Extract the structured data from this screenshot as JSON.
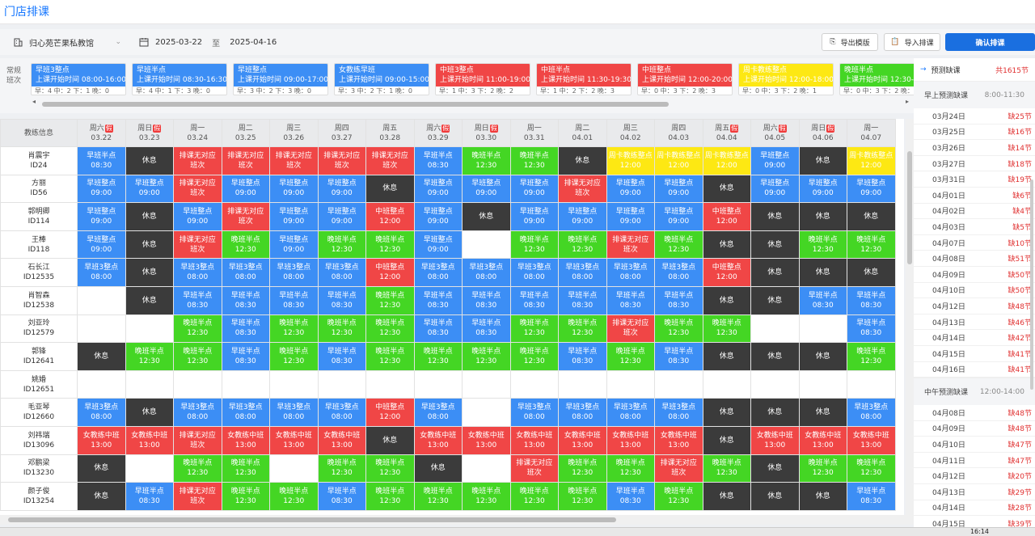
{
  "title": "门店排课",
  "toolbar": {
    "store": "归心苑芒果私教馆",
    "date_from": "2025-03-22",
    "date_sep": "至",
    "date_to": "2025-04-16",
    "export_label": "导出模版",
    "import_label": "导入排课",
    "confirm_label": "确认排课"
  },
  "shift_label": "常规班次",
  "shifts": [
    {
      "name": "早班3整点",
      "time": "上课开始时间 08:00-16:00",
      "stats": "早：4 中：2 下：1 晚：0",
      "color": "blue"
    },
    {
      "name": "早班半点",
      "time": "上课开始时间 08:30-16:30",
      "stats": "早：4 中：1 下：3 晚：0",
      "color": "blue"
    },
    {
      "name": "早班整点",
      "time": "上课开始时间 09:00-17:00",
      "stats": "早：3 中：2 下：3 晚：0",
      "color": "blue"
    },
    {
      "name": "女教练早班",
      "time": "上课开始时间 09:00-15:00",
      "stats": "早：3 中：2 下：1 晚：0",
      "color": "blue"
    },
    {
      "name": "中班3整点",
      "time": "上课开始时间 11:00-19:00",
      "stats": "早：1 中：3 下：2 晚：2",
      "color": "red"
    },
    {
      "name": "中班半点",
      "time": "上课开始时间 11:30-19:30",
      "stats": "早：1 中：2 下：2 晚：3",
      "color": "red"
    },
    {
      "name": "中班整点",
      "time": "上课开始时间 12:00-20:00",
      "stats": "早：0 中：3 下：2 晚：3",
      "color": "red"
    },
    {
      "name": "周卡教练整点",
      "time": "上课开始时间 12:00-18:00",
      "stats": "早：0 中：3 下：2 晚：1",
      "color": "yellow"
    },
    {
      "name": "晚班半点",
      "time": "上课开始时间 12:30-",
      "stats": "早：0 中：3 下：2 晚：3",
      "color": "green"
    }
  ],
  "grid": {
    "coach_header": "教练信息",
    "days": [
      {
        "wd": "周六",
        "date": "03.22",
        "hol": true
      },
      {
        "wd": "周日",
        "date": "03.23",
        "hol": true
      },
      {
        "wd": "周一",
        "date": "03.24",
        "hol": false
      },
      {
        "wd": "周二",
        "date": "03.25",
        "hol": false
      },
      {
        "wd": "周三",
        "date": "03.26",
        "hol": false
      },
      {
        "wd": "周四",
        "date": "03.27",
        "hol": false
      },
      {
        "wd": "周五",
        "date": "03.28",
        "hol": false
      },
      {
        "wd": "周六",
        "date": "03.29",
        "hol": true
      },
      {
        "wd": "周日",
        "date": "03.30",
        "hol": true
      },
      {
        "wd": "周一",
        "date": "03.31",
        "hol": false
      },
      {
        "wd": "周二",
        "date": "04.01",
        "hol": false
      },
      {
        "wd": "周三",
        "date": "04.02",
        "hol": false
      },
      {
        "wd": "周四",
        "date": "04.03",
        "hol": false
      },
      {
        "wd": "周五",
        "date": "04.04",
        "hol": true
      },
      {
        "wd": "周六",
        "date": "04.05",
        "hol": true
      },
      {
        "wd": "周日",
        "date": "04.06",
        "hol": true
      },
      {
        "wd": "周一",
        "date": "04.07",
        "hol": false
      }
    ],
    "hol_badge": "假",
    "rows": [
      {
        "name": "肖震宇",
        "id": "ID24",
        "cells": [
          "B|早班半点|08:30",
          "D|休息|",
          "R|排课无对应|班次",
          "R|排课无对应|班次",
          "R|排课无对应|班次",
          "R|排课无对应|班次",
          "R|排课无对应|班次",
          "B|早班半点|08:30",
          "G|晚班半点|12:30",
          "G|晚班半点|12:30",
          "D|休息|",
          "Y|周卡教练整点|12:00",
          "Y|周卡教练整点|12:00",
          "Y|周卡教练整点|12:00",
          "B|早班整点|09:00",
          "D|休息|",
          "Y|周卡教练整点|12:00"
        ]
      },
      {
        "name": "方丽",
        "id": "ID56",
        "cells": [
          "B|早班整点|09:00",
          "B|早班整点|09:00",
          "R|排课无对应|班次",
          "B|早班整点|09:00",
          "B|早班整点|09:00",
          "B|早班整点|09:00",
          "D|休息|",
          "B|早班整点|09:00",
          "B|早班整点|09:00",
          "B|早班整点|09:00",
          "R|排课无对应|班次",
          "B|早班整点|09:00",
          "B|早班整点|09:00",
          "D|休息|",
          "B|早班整点|09:00",
          "B|早班整点|09:00",
          "B|早班整点|09:00"
        ]
      },
      {
        "name": "郭明卿",
        "id": "ID114",
        "cells": [
          "B|早班整点|09:00",
          "D|休息|",
          "B|早班整点|09:00",
          "R|排课无对应|班次",
          "B|早班整点|09:00",
          "B|早班整点|09:00",
          "R|中班整点|12:00",
          "B|早班整点|09:00",
          "D|休息|",
          "B|早班整点|09:00",
          "B|早班整点|09:00",
          "B|早班整点|09:00",
          "B|早班整点|09:00",
          "R|中班整点|12:00",
          "D|休息|",
          "D|休息|",
          "D|休息|"
        ]
      },
      {
        "name": "王棒",
        "id": "ID118",
        "cells": [
          "B|早班整点|09:00",
          "D|休息|",
          "R|排课无对应|班次",
          "G|晚班半点|12:30",
          "B|早班整点|09:00",
          "G|晚班半点|12:30",
          "G|晚班半点|12:30",
          "B|早班整点|09:00",
          "E||",
          "G|晚班半点|12:30",
          "G|晚班半点|12:30",
          "R|排课无对应|班次",
          "G|晚班半点|12:30",
          "D|休息|",
          "D|休息|",
          "G|晚班半点|12:30",
          "G|晚班半点|12:30"
        ]
      },
      {
        "name": "石长江",
        "id": "ID12535",
        "cells": [
          "B|早班3整点|08:00",
          "D|休息|",
          "B|早班3整点|08:00",
          "B|早班3整点|08:00",
          "B|早班3整点|08:00",
          "B|早班3整点|08:00",
          "R|中班整点|12:00",
          "B|早班3整点|08:00",
          "B|早班3整点|08:00",
          "B|早班3整点|08:00",
          "B|早班3整点|08:00",
          "B|早班3整点|08:00",
          "B|早班3整点|08:00",
          "R|中班整点|12:00",
          "D|休息|",
          "D|休息|",
          "D|休息|"
        ]
      },
      {
        "name": "肖智森",
        "id": "ID12538",
        "cells": [
          "E||",
          "D|休息|",
          "B|早班半点|08:30",
          "B|早班半点|08:30",
          "B|早班半点|08:30",
          "B|早班半点|08:30",
          "G|晚班半点|12:30",
          "B|早班半点|08:30",
          "B|早班半点|08:30",
          "B|早班半点|08:30",
          "B|早班半点|08:30",
          "B|早班半点|08:30",
          "B|早班半点|08:30",
          "D|休息|",
          "D|休息|",
          "B|早班半点|08:30",
          "B|早班半点|08:30"
        ]
      },
      {
        "name": "刘亚玲",
        "id": "ID12579",
        "cells": [
          "E||",
          "E||",
          "G|晚班半点|12:30",
          "B|早班半点|08:30",
          "G|晚班半点|12:30",
          "G|晚班半点|12:30",
          "G|晚班半点|12:30",
          "B|早班半点|08:30",
          "B|早班半点|08:30",
          "G|晚班半点|12:30",
          "G|晚班半点|12:30",
          "R|排课无对应|班次",
          "G|晚班半点|12:30",
          "G|晚班半点|12:30",
          "E||",
          "E||",
          "B|早班半点|08:30"
        ]
      },
      {
        "name": "郭锋",
        "id": "ID12641",
        "cells": [
          "D|休息|",
          "G|晚班半点|12:30",
          "G|晚班半点|12:30",
          "B|早班半点|08:30",
          "G|晚班半点|12:30",
          "B|早班半点|08:30",
          "G|晚班半点|12:30",
          "G|晚班半点|12:30",
          "G|晚班半点|12:30",
          "G|晚班半点|12:30",
          "B|早班半点|08:30",
          "G|晚班半点|12:30",
          "B|早班半点|08:30",
          "D|休息|",
          "D|休息|",
          "D|休息|",
          "G|晚班半点|12:30"
        ]
      },
      {
        "name": "姚婚",
        "id": "ID12651",
        "cells": [
          "E||",
          "E||",
          "E||",
          "E||",
          "E||",
          "E||",
          "E||",
          "E||",
          "E||",
          "E||",
          "E||",
          "E||",
          "E||",
          "E||",
          "E||",
          "E||",
          "E||"
        ]
      },
      {
        "name": "毛亚琴",
        "id": "ID12660",
        "cells": [
          "B|早班3整点|08:00",
          "D|休息|",
          "B|早班3整点|08:00",
          "B|早班3整点|08:00",
          "B|早班3整点|08:00",
          "B|早班3整点|08:00",
          "R|中班整点|12:00",
          "B|早班3整点|08:00",
          "E||",
          "B|早班3整点|08:00",
          "B|早班3整点|08:00",
          "B|早班3整点|08:00",
          "B|早班3整点|08:00",
          "D|休息|",
          "D|休息|",
          "D|休息|",
          "B|早班3整点|08:00"
        ]
      },
      {
        "name": "刘祎瑞",
        "id": "ID13096",
        "cells": [
          "R|女教练中班|13:00",
          "R|女教练中班|13:00",
          "R|排课无对应|班次",
          "R|女教练中班|13:00",
          "R|女教练中班|13:00",
          "R|女教练中班|13:00",
          "D|休息|",
          "R|女教练中班|13:00",
          "R|女教练中班|13:00",
          "R|女教练中班|13:00",
          "R|女教练中班|13:00",
          "R|女教练中班|13:00",
          "R|女教练中班|13:00",
          "D|休息|",
          "R|女教练中班|13:00",
          "R|女教练中班|13:00",
          "R|女教练中班|13:00"
        ]
      },
      {
        "name": "邓鹏梁",
        "id": "ID13230",
        "cells": [
          "D|休息|",
          "E||",
          "G|晚班半点|12:30",
          "G|晚班半点|12:30",
          "E||",
          "G|晚班半点|12:30",
          "G|晚班半点|12:30",
          "D|休息|",
          "E||",
          "R|排课无对应|班次",
          "G|晚班半点|12:30",
          "G|晚班半点|12:30",
          "R|排课无对应|班次",
          "G|晚班半点|12:30",
          "D|休息|",
          "G|晚班半点|12:30",
          "G|晚班半点|12:30"
        ]
      },
      {
        "name": "颜子俊",
        "id": "ID13254",
        "cells": [
          "D|休息|",
          "B|早班半点|08:30",
          "R|排课无对应|班次",
          "G|晚班半点|12:30",
          "G|晚班半点|12:30",
          "B|早班半点|08:30",
          "G|晚班半点|12:30",
          "G|晚班半点|12:30",
          "G|晚班半点|12:30",
          "G|晚班半点|12:30",
          "G|晚班半点|12:30",
          "B|早班半点|08:30",
          "G|晚班半点|12:30",
          "D|休息|",
          "D|休息|",
          "D|休息|",
          "B|早班半点|08:30"
        ]
      }
    ]
  },
  "side": {
    "header": "预测缺课",
    "total": "共1615节",
    "sections": [
      {
        "title": "早上预测缺课",
        "range": "8:00-11:30",
        "items": [
          [
            "03月24日",
            "缺25节"
          ],
          [
            "03月25日",
            "缺16节"
          ],
          [
            "03月26日",
            "缺14节"
          ],
          [
            "03月27日",
            "缺18节"
          ],
          [
            "03月31日",
            "缺19节"
          ],
          [
            "04月01日",
            "缺6节"
          ],
          [
            "04月02日",
            "缺4节"
          ],
          [
            "04月03日",
            "缺5节"
          ],
          [
            "04月07日",
            "缺10节"
          ],
          [
            "04月08日",
            "缺51节"
          ],
          [
            "04月09日",
            "缺50节"
          ],
          [
            "04月10日",
            "缺50节"
          ],
          [
            "04月12日",
            "缺48节"
          ],
          [
            "04月13日",
            "缺46节"
          ],
          [
            "04月14日",
            "缺42节"
          ],
          [
            "04月15日",
            "缺41节"
          ],
          [
            "04月16日",
            "缺41节"
          ]
        ]
      },
      {
        "title": "中午预测缺课",
        "range": "12:00-14:00",
        "items": [
          [
            "04月08日",
            "缺48节"
          ],
          [
            "04月09日",
            "缺48节"
          ],
          [
            "04月10日",
            "缺47节"
          ],
          [
            "04月11日",
            "缺47节"
          ],
          [
            "04月12日",
            "缺20节"
          ],
          [
            "04月13日",
            "缺29节"
          ],
          [
            "04月14日",
            "缺28节"
          ],
          [
            "04月15日",
            "缺39节"
          ]
        ]
      }
    ]
  },
  "taskbar": {
    "time": "16:14"
  }
}
